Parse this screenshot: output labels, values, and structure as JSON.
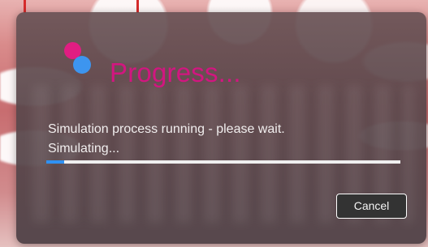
{
  "dialog": {
    "title": "Progress...",
    "message_line_1": "Simulation process running - please wait.",
    "message_line_2": "Simulating...",
    "progress_fraction": 0.05,
    "cancel_label": "Cancel"
  },
  "colors": {
    "title": "#d21680",
    "progress_fill": "#2f91f3",
    "logo_pink": "#e11d82",
    "logo_blue": "#3d95ef"
  }
}
